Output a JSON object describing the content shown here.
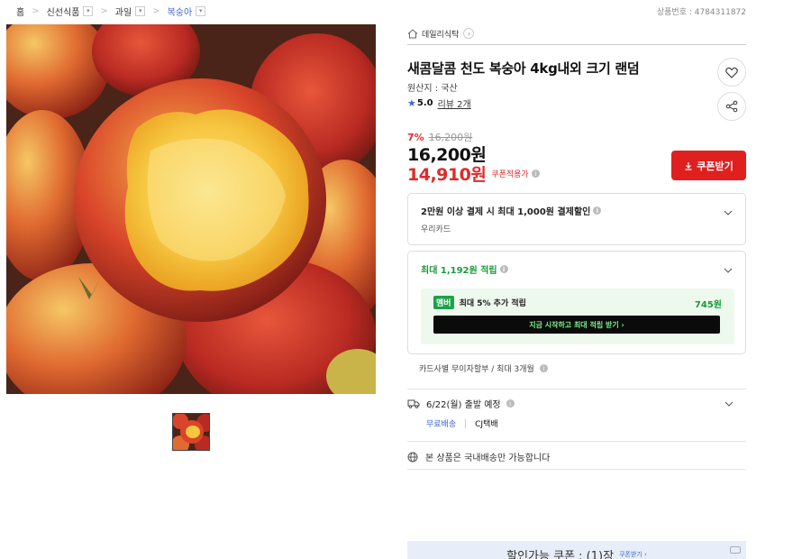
{
  "breadcrumb": {
    "home": "홈",
    "level1": "신선식품",
    "level2": "과일",
    "level3": "복숭아"
  },
  "product_no": "상품번호 : 4784311872",
  "store": {
    "name": "데일리식탁"
  },
  "product": {
    "title": "새콤달콤 천도 복숭아 4kg내외 크기 랜덤",
    "origin": "원산지 : 국산",
    "rating": "5.0",
    "review_link": "리뷰 2개"
  },
  "pricing": {
    "discount_rate": "7%",
    "original_price": "16,200원",
    "price": "16,200원",
    "coupon_price": "14,910원",
    "coupon_note": "쿠폰적용가",
    "coupon_button": "쿠폰받기"
  },
  "card_discount": {
    "title": "2만원 이상 결제 시 최대 1,000원 결제할인",
    "card": "우리카드"
  },
  "points": {
    "head": "최대 1,192원 적립",
    "member_badge": "멤버",
    "member_text": "최대 5% 추가 적립",
    "member_amount": "745원",
    "member_button": "지금 시작하고 최대 적립 받기 ›"
  },
  "installment": "카드사별 무이자할부 / 최대 3개월",
  "shipping": {
    "date": "6/22(월) 출발 예정",
    "fee": "무료배송",
    "courier": "CJ택배"
  },
  "domestic_notice": "본 상품은 국내배송만 가능합니다",
  "coupon_banner": {
    "text": "할인가능 쿠폰 : (1)장",
    "sub": "쿠폰받기 ›"
  },
  "colors": {
    "accent_red": "#e0201f",
    "accent_blue": "#3d67d6",
    "accent_green": "#1a9a3a"
  },
  "icons": [
    "home-icon",
    "heart-icon",
    "share-icon",
    "star-icon",
    "download-icon",
    "chevron-down-icon",
    "truck-icon",
    "globe-icon",
    "info-icon"
  ]
}
